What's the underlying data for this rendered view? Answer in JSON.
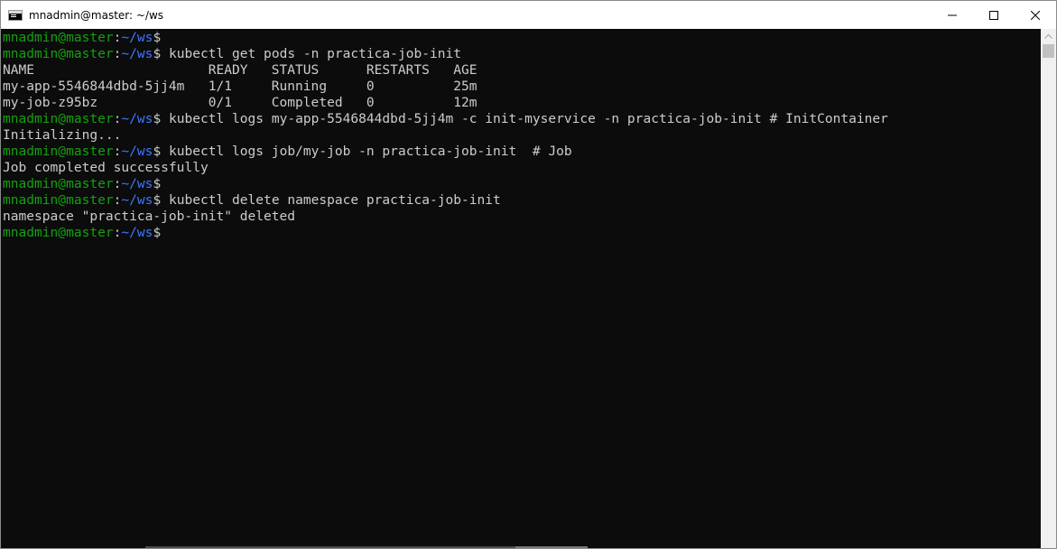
{
  "window": {
    "title": "mnadmin@master: ~/ws",
    "app_icon": "console-icon",
    "controls": [
      "minimize-icon",
      "maximize-icon",
      "close-icon"
    ]
  },
  "prompt": {
    "user_host": "mnadmin@master",
    "separator": ":",
    "path": "~/ws",
    "symbol": "$"
  },
  "colors": {
    "background": "#0c0c0c",
    "text": "#cccccc",
    "user_host": "#13a10e",
    "path": "#3b78ff"
  },
  "lines": [
    {
      "type": "prompt",
      "command": ""
    },
    {
      "type": "prompt",
      "command": " kubectl get pods -n practica-job-init"
    },
    {
      "type": "output",
      "text": "NAME                      READY   STATUS      RESTARTS   AGE"
    },
    {
      "type": "output",
      "text": "my-app-5546844dbd-5jj4m   1/1     Running     0          25m"
    },
    {
      "type": "output",
      "text": "my-job-z95bz              0/1     Completed   0          12m"
    },
    {
      "type": "prompt",
      "command": " kubectl logs my-app-5546844dbd-5jj4m -c init-myservice -n practica-job-init # InitContainer"
    },
    {
      "type": "output",
      "text": "Initializing..."
    },
    {
      "type": "prompt",
      "command": " kubectl logs job/my-job -n practica-job-init  # Job"
    },
    {
      "type": "output",
      "text": "Job completed successfully"
    },
    {
      "type": "prompt",
      "command": ""
    },
    {
      "type": "prompt",
      "command": " kubectl delete namespace practica-job-init"
    },
    {
      "type": "output",
      "text": "namespace \"practica-job-init\" deleted"
    },
    {
      "type": "prompt",
      "command": ""
    }
  ]
}
